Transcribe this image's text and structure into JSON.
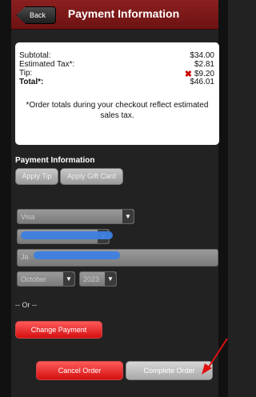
{
  "header": {
    "back_label": "Back",
    "title": "Payment Information"
  },
  "totals": {
    "subtotal_label": "Subtotal:",
    "subtotal_value": "$34.00",
    "tax_label": "Estimated Tax*:",
    "tax_value": "$2.81",
    "tip_label": "Tip:",
    "tip_value": "$9.20",
    "total_label": "Total*:",
    "total_value": "$46.01",
    "note": "*Order totals during your checkout reflect estimated sales tax."
  },
  "payment": {
    "section_title": "Payment Information",
    "apply_tip_label": "Apply Tip",
    "apply_gift_card_label": "Apply Gift Card",
    "card_type": "Visa",
    "name_prefix": "Ja",
    "exp_month": "October",
    "exp_year": "2023",
    "or_text": "-- Or --",
    "change_payment_label": "Change Payment"
  },
  "actions": {
    "cancel_label": "Cancel Order",
    "complete_label": "Complete Order"
  },
  "colors": {
    "header": "#7a1616",
    "red_button": "#e22222",
    "annotation_arrow": "#e01010",
    "redaction": "#3d7fe0"
  }
}
